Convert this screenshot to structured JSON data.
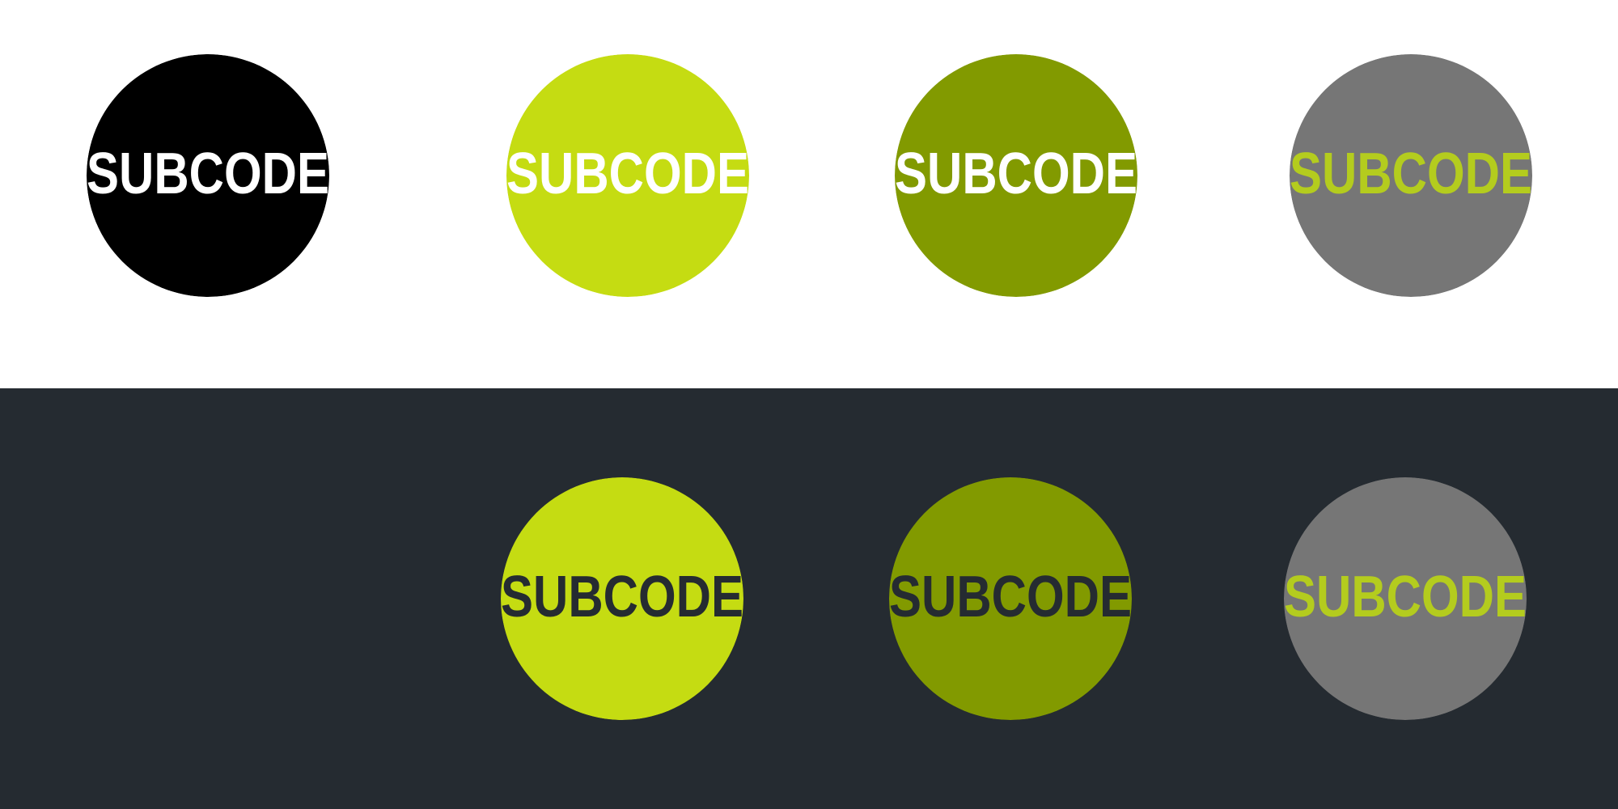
{
  "logo_text": "SUBCODE",
  "rows": [
    {
      "background": "#ffffff",
      "badges": [
        {
          "circle_color": "#000000",
          "text_color": "#ffffff"
        },
        {
          "circle_color": "#c5dc12",
          "text_color": "#ffffff"
        },
        {
          "circle_color": "#829a00",
          "text_color": "#ffffff"
        },
        {
          "circle_color": "#767676",
          "text_color": "#b4cc1e"
        }
      ]
    },
    {
      "background": "#252b31",
      "badges": [
        {
          "circle_color": "#c5dc12",
          "text_color": "#252b31"
        },
        {
          "circle_color": "#829a00",
          "text_color": "#252b31"
        },
        {
          "circle_color": "#767676",
          "text_color": "#b4cc1e"
        }
      ]
    }
  ]
}
